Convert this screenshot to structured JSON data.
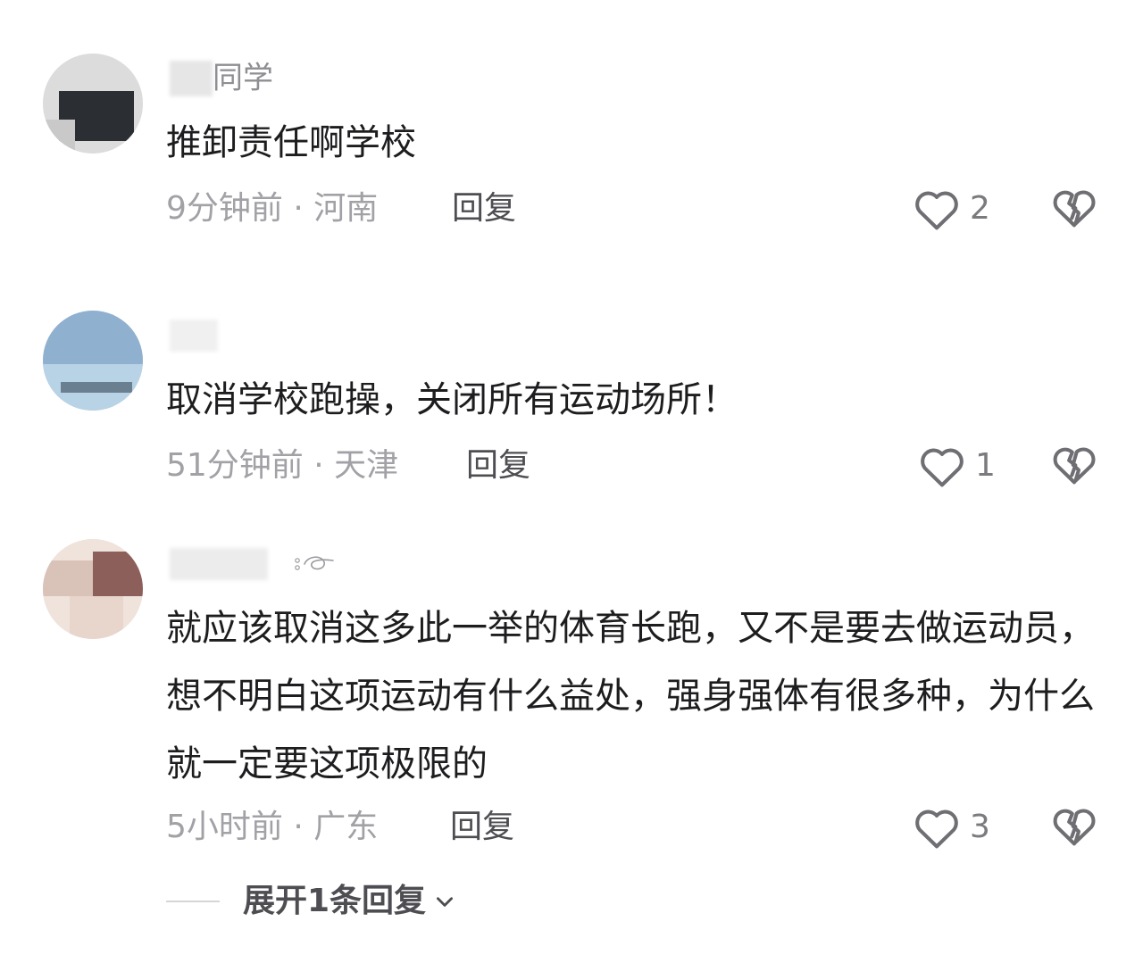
{
  "comments": [
    {
      "username_visible": "同学",
      "text": "推卸责任啊学校",
      "time": "9分钟前",
      "location": "河南",
      "reply_label": "回复",
      "likes": "2"
    },
    {
      "username_visible": "",
      "text": "取消学校跑操，关闭所有运动场所！",
      "time": "51分钟前",
      "location": "天津",
      "reply_label": "回复",
      "likes": "1"
    },
    {
      "username_visible": "",
      "text": "就应该取消这多此一举的体育长跑，又不是要去做运动员，想不明白这项运动有什么益处，强身强体有很多种，为什么就一定要这项极限的",
      "time": "5小时前",
      "location": "广东",
      "reply_label": "回复",
      "likes": "3"
    }
  ],
  "separator": "·",
  "expand_replies_label": "展开1条回复",
  "icons": {
    "like": "heart-outline-icon",
    "dislike": "broken-heart-icon",
    "expand": "chevron-down-icon"
  },
  "colors": {
    "text_primary": "#1d1d1f",
    "text_secondary": "#a1a1a6",
    "text_action": "#4d4d52",
    "icon": "#6e6e73"
  }
}
